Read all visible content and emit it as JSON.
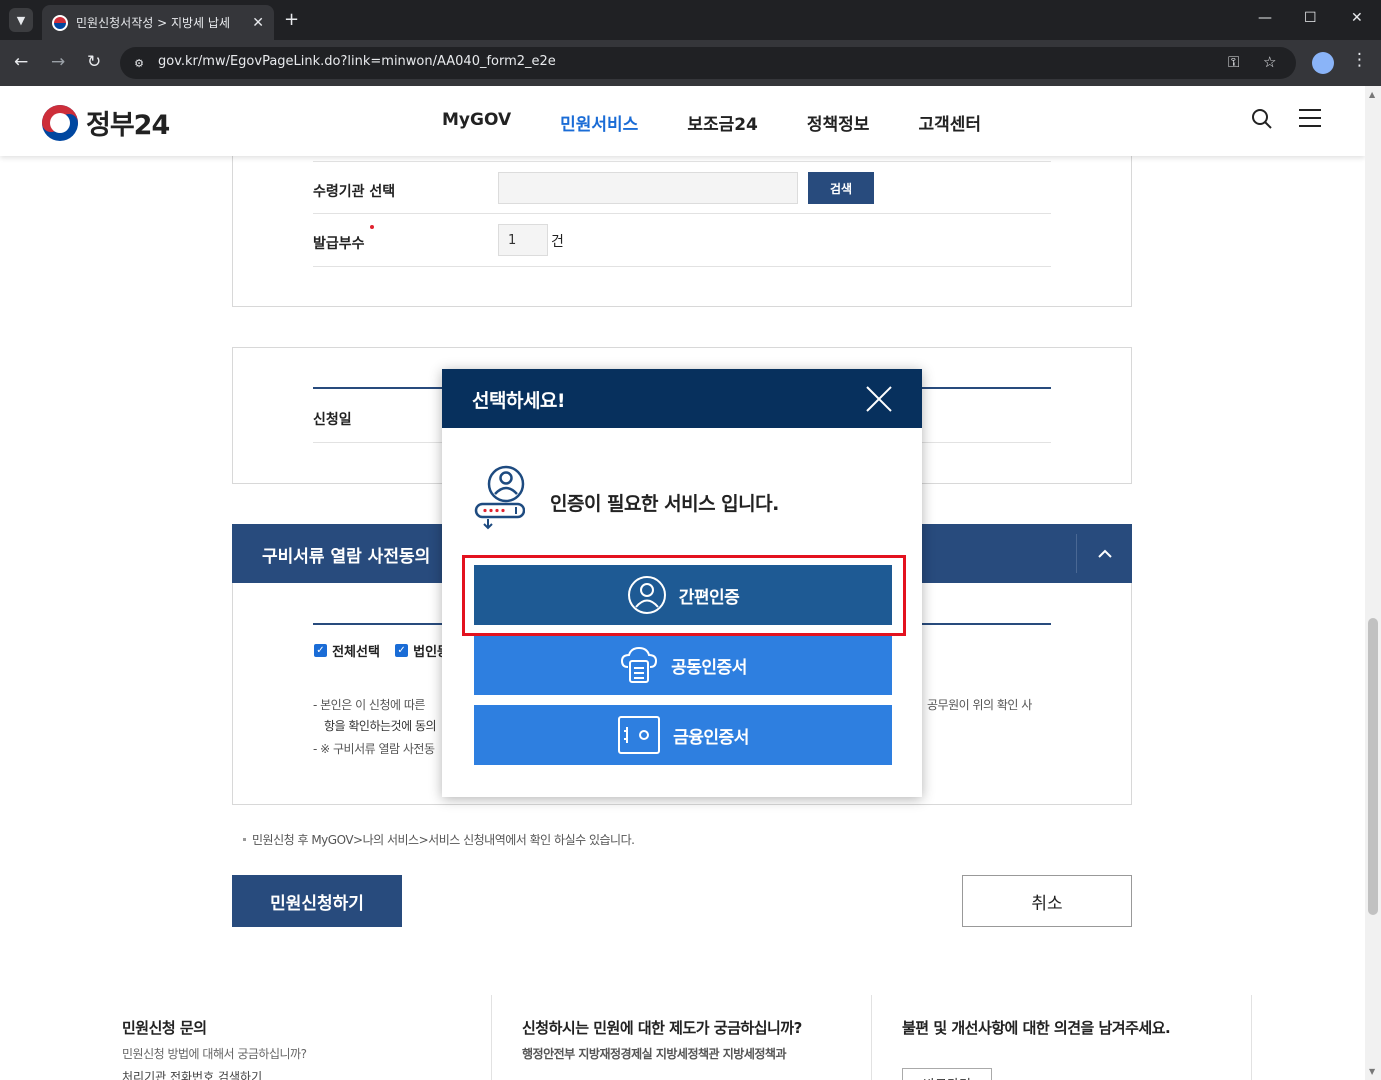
{
  "browser": {
    "tab_title": "민원신청서작성 > 지방세 납세",
    "url": "gov.kr/mw/EgovPageLink.do?link=minwon/AA040_form2_e2e"
  },
  "header": {
    "logo_text": "정부24",
    "nav": [
      "MyGOV",
      "민원서비스",
      "보조금24",
      "정책정보",
      "고객센터"
    ],
    "active_nav": "민원서비스"
  },
  "form": {
    "agency_label": "수령기관 선택",
    "agency_value": "",
    "search_button": "검색",
    "copies_label": "발급부수",
    "copies_value": "1",
    "copies_unit": "건",
    "apply_date_label": "신청일"
  },
  "consent": {
    "title": "구비서류 열람 사전동의",
    "check_all": "전체선택",
    "check_corp": "법인등",
    "text_line1_left": "- 본인은 이 신청에 따른",
    "text_line1_right": "공무원이 위의 확인 사",
    "text_line2": "항을 확인하는것에 동의",
    "text_line3": "- ※ 구비서류 열람 사전동"
  },
  "note": "민원신청 후 MyGOV>나의 서비스>서비스 신청내역에서 확인 하실수 있습니다.",
  "buttons": {
    "apply": "민원신청하기",
    "cancel": "취소"
  },
  "footer": {
    "col1_title": "민원신청 문의",
    "col1_desc": "민원신청 방법에 대해서 궁금하십니까?",
    "col1_link": "처리기관 전화번호 검색하기",
    "col2_title": "신청하시는 민원에 대한 제도가 궁금하십니까?",
    "col2_desc": "행정안전부 지방재정경제실 지방세정책관 지방세정책과",
    "col3_title": "불편 및 개선사항에 대한 의견을 남겨주세요.",
    "col3_button": "바로가기"
  },
  "modal": {
    "title": "선택하세요!",
    "message": "인증이 필요한 서비스 입니다.",
    "options": [
      "간편인증",
      "공동인증서",
      "금융인증서"
    ],
    "highlighted_option": "간편인증"
  },
  "colors": {
    "navy": "#284b7d",
    "modal_header": "#07305d",
    "simple_auth": "#1e5a94",
    "cert_button": "#2e7fe0",
    "highlight": "#e3121f",
    "active_nav": "#1a6cd6"
  }
}
